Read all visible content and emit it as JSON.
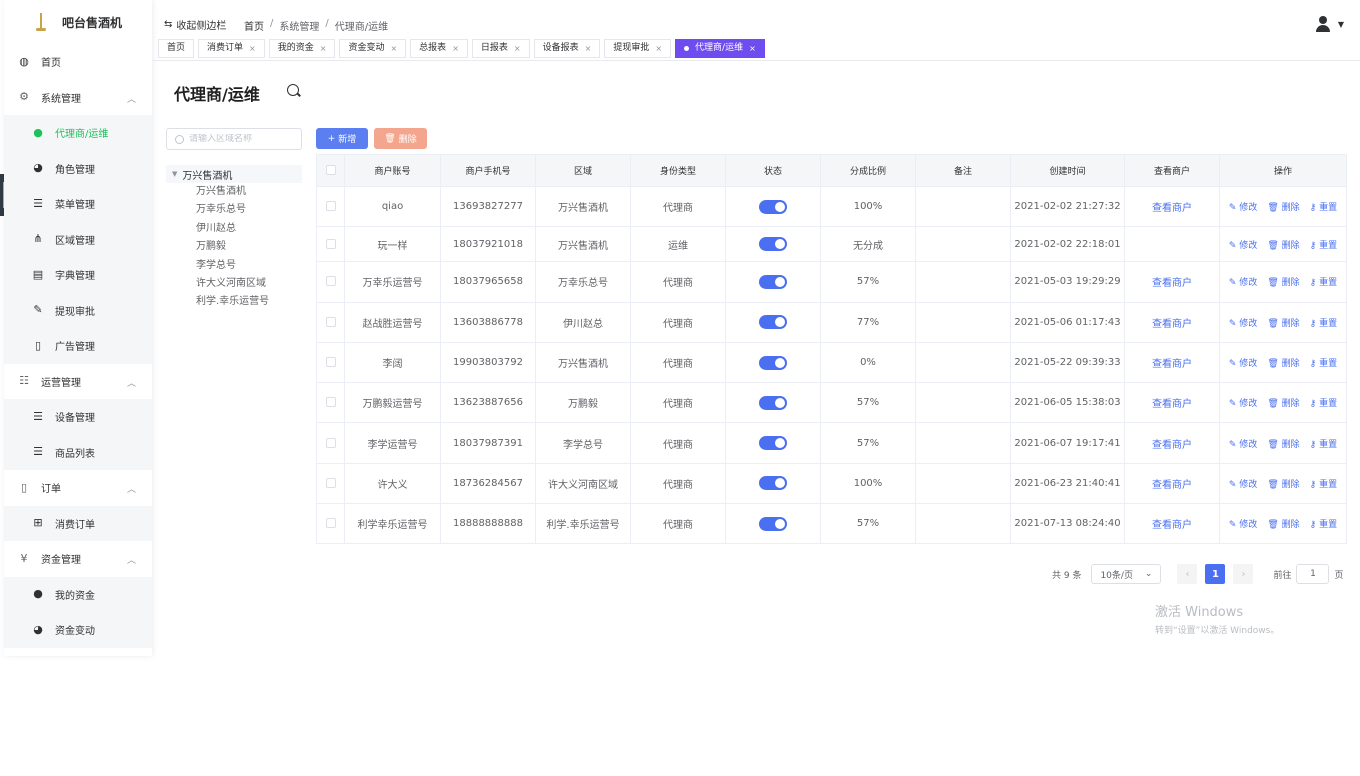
{
  "app": {
    "name": "吧台售酒机"
  },
  "sidebar": {
    "items": [
      {
        "label": "首页",
        "icon": "dashboard-icon",
        "glyph": "◍",
        "type": "top"
      },
      {
        "label": "系统管理",
        "icon": "gear-icon",
        "glyph": "⚙",
        "type": "group"
      },
      {
        "label": "代理商/运维",
        "icon": "user-icon",
        "glyph": "●",
        "type": "sub",
        "active": true
      },
      {
        "label": "角色管理",
        "icon": "users-icon",
        "glyph": "◕",
        "type": "sub"
      },
      {
        "label": "菜单管理",
        "icon": "list-icon",
        "glyph": "☰",
        "type": "sub"
      },
      {
        "label": "区域管理",
        "icon": "sitemap-icon",
        "glyph": "⋔",
        "type": "sub"
      },
      {
        "label": "字典管理",
        "icon": "dictionary-icon",
        "glyph": "▤",
        "type": "sub"
      },
      {
        "label": "提现审批",
        "icon": "edit-icon",
        "glyph": "✎",
        "type": "sub"
      },
      {
        "label": "广告管理",
        "icon": "book-icon",
        "glyph": "▯",
        "type": "sub"
      },
      {
        "label": "运营管理",
        "icon": "sliders-icon",
        "glyph": "☷",
        "type": "group"
      },
      {
        "label": "设备管理",
        "icon": "list-ordered-icon",
        "glyph": "☰",
        "type": "sub"
      },
      {
        "label": "商品列表",
        "icon": "list-icon",
        "glyph": "☰",
        "type": "sub"
      },
      {
        "label": "订单",
        "icon": "book-icon",
        "glyph": "▯",
        "type": "group"
      },
      {
        "label": "消费订单",
        "icon": "cart-icon",
        "glyph": "⊞",
        "type": "sub"
      },
      {
        "label": "资金管理",
        "icon": "yen-icon",
        "glyph": "¥",
        "type": "group"
      },
      {
        "label": "我的资金",
        "icon": "user-icon",
        "glyph": "●",
        "type": "sub"
      },
      {
        "label": "资金变动",
        "icon": "users-icon",
        "glyph": "◕",
        "type": "sub"
      }
    ]
  },
  "topbar": {
    "collapse_label": "收起侧边栏",
    "breadcrumb": [
      "首页",
      "系统管理",
      "代理商/运维"
    ]
  },
  "tabs": [
    {
      "label": "首页",
      "closable": false
    },
    {
      "label": "消费订单",
      "closable": true
    },
    {
      "label": "我的资金",
      "closable": true
    },
    {
      "label": "资金变动",
      "closable": true
    },
    {
      "label": "总报表",
      "closable": true
    },
    {
      "label": "日报表",
      "closable": true
    },
    {
      "label": "设备报表",
      "closable": true
    },
    {
      "label": "提现审批",
      "closable": true
    },
    {
      "label": "代理商/运维",
      "closable": true,
      "active": true
    }
  ],
  "page": {
    "title": "代理商/运维"
  },
  "tree": {
    "search_placeholder": "请输入区域名称",
    "root": "万兴售酒机",
    "children": [
      "万兴售酒机",
      "万幸乐总号",
      "伊川赵总",
      "万鹏毅",
      "李学总号",
      "许大义河南区域",
      "利学.幸乐运营号"
    ]
  },
  "actions": {
    "add_label": "新增",
    "delete_label": "删除"
  },
  "table": {
    "columns": [
      "商户账号",
      "商户手机号",
      "区域",
      "身份类型",
      "状态",
      "分成比例",
      "备注",
      "创建时间",
      "查看商户",
      "操作"
    ],
    "rows": [
      {
        "account": "qiao",
        "phone": "13693827277",
        "area": "万兴售酒机",
        "type": "代理商",
        "ratio": "100%",
        "remark": "",
        "created": "2021-02-02 21:27:32",
        "view": "查看商户"
      },
      {
        "account": "玩一样",
        "phone": "18037921018",
        "area": "万兴售酒机",
        "type": "运维",
        "ratio": "无分成",
        "remark": "",
        "created": "2021-02-02 22:18:01",
        "view": ""
      },
      {
        "account": "万幸乐运营号",
        "phone": "18037965658",
        "area": "万幸乐总号",
        "type": "代理商",
        "ratio": "57%",
        "remark": "",
        "created": "2021-05-03 19:29:29",
        "view": "查看商户"
      },
      {
        "account": "赵战胜运营号",
        "phone": "13603886778",
        "area": "伊川赵总",
        "type": "代理商",
        "ratio": "77%",
        "remark": "",
        "created": "2021-05-06 01:17:43",
        "view": "查看商户"
      },
      {
        "account": "李阔",
        "phone": "19903803792",
        "area": "万兴售酒机",
        "type": "代理商",
        "ratio": "0%",
        "remark": "",
        "created": "2021-05-22 09:39:33",
        "view": "查看商户"
      },
      {
        "account": "万鹏毅运营号",
        "phone": "13623887656",
        "area": "万鹏毅",
        "type": "代理商",
        "ratio": "57%",
        "remark": "",
        "created": "2021-06-05 15:38:03",
        "view": "查看商户"
      },
      {
        "account": "李学运营号",
        "phone": "18037987391",
        "area": "李学总号",
        "type": "代理商",
        "ratio": "57%",
        "remark": "",
        "created": "2021-06-07 19:17:41",
        "view": "查看商户"
      },
      {
        "account": "许大义",
        "phone": "18736284567",
        "area": "许大义河南区域",
        "type": "代理商",
        "ratio": "100%",
        "remark": "",
        "created": "2021-06-23 21:40:41",
        "view": "查看商户"
      },
      {
        "account": "利学幸乐运营号",
        "phone": "18888888888",
        "area": "利学.幸乐运营号",
        "type": "代理商",
        "ratio": "57%",
        "remark": "",
        "created": "2021-07-13 08:24:40",
        "view": "查看商户"
      }
    ],
    "ops": {
      "edit": "修改",
      "delete": "删除",
      "reset": "重置"
    }
  },
  "pagination": {
    "total": "共 9 条",
    "page_size": "10条/页",
    "current": "1",
    "goto_label": "前往",
    "goto_value": "1",
    "page_unit": "页"
  },
  "watermark": {
    "title": "激活 Windows",
    "subtitle": "转到“设置”以激活 Windows。"
  },
  "colors": {
    "primary": "#4a6ff0",
    "active_menu": "#20c05c",
    "active_tab": "#6f4cf0",
    "delete_btn": "#f4a58e"
  }
}
